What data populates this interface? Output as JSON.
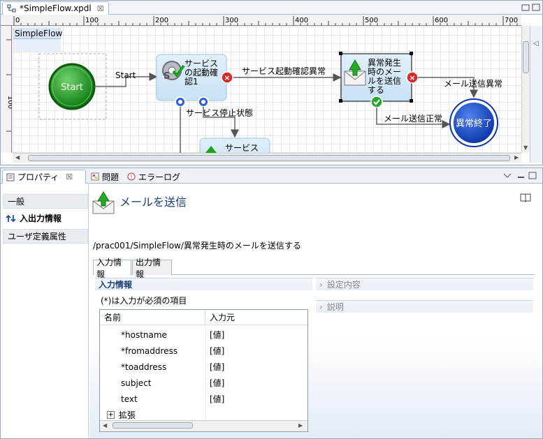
{
  "editor": {
    "tab_title": "*SimpleFlow.xpdl",
    "tab_close": "☒",
    "ruler_ticks": [
      "0",
      "100",
      "200",
      "300",
      "400",
      "500",
      "600",
      "700"
    ],
    "ruler_v_label": "100",
    "diagram": {
      "pool_label": "SimpleFlow",
      "start_label": "Start",
      "edge_start": "Start",
      "task1_label": [
        "サービス",
        "の起動確",
        "認1"
      ],
      "edge_task1_error": "サービス起動確認異常",
      "edge_task1_stop": "サービス停止状態",
      "task2_label": [
        "異常発生",
        "時のメー",
        "ルを送信",
        "する"
      ],
      "edge_task2_error": "メール送信異常",
      "edge_task2_ok": "メール送信正常",
      "end_label": "異常終了",
      "task3_label": "サービス"
    }
  },
  "props": {
    "tabs": [
      {
        "label": "プロパティ",
        "close": "☒"
      },
      {
        "label": "問題"
      },
      {
        "label": "エラーログ"
      }
    ],
    "nav": [
      {
        "label": "一般"
      },
      {
        "label": "入出力情報"
      },
      {
        "label": "ユーザ定義属性"
      }
    ],
    "header_title": "メールを送信",
    "path": "/prac001/SimpleFlow/異常発生時のメールを送信する",
    "subtabs": [
      "入力情報",
      "出力情報"
    ],
    "section_input": "入力情報",
    "required_note": "(*)は入力が必須の項目",
    "section_settings": "設定内容",
    "section_desc": "説明",
    "table": {
      "col_name": "名前",
      "col_src": "入力元",
      "rows": [
        {
          "name": "*hostname",
          "src": "[値]"
        },
        {
          "name": "*fromaddress",
          "src": "[値]"
        },
        {
          "name": "*toaddress",
          "src": "[値]"
        },
        {
          "name": "subject",
          "src": "[値]"
        },
        {
          "name": "text",
          "src": "[値]"
        }
      ],
      "expand_label": "拡張",
      "expand_toggle": "+"
    }
  }
}
